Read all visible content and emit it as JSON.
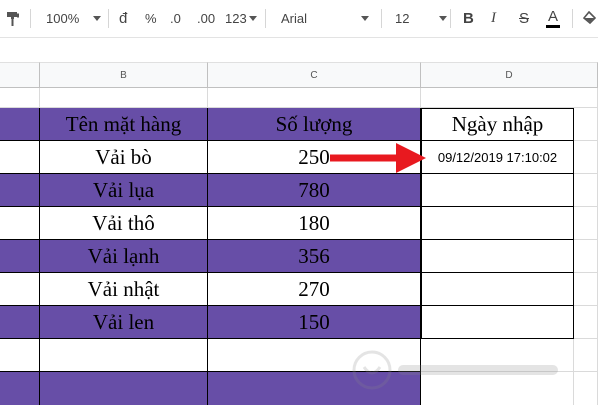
{
  "toolbar": {
    "zoom": "100%",
    "currency_symbol": "đ",
    "percent_symbol": "%",
    "decrease_decimals": ".0",
    "increase_decimals": ".00",
    "more_formats": "123",
    "font": "Arial",
    "font_size": "12",
    "bold": "B",
    "italic": "I",
    "strikethrough": "S",
    "text_color": "A"
  },
  "columns": [
    "B",
    "C",
    "D"
  ],
  "table": {
    "headers": [
      "Tên mặt hàng",
      "Số lượng",
      "Ngày nhập"
    ],
    "rows": [
      {
        "name": "Vải bò",
        "qty": "250",
        "date": "09/12/2019 17:10:02"
      },
      {
        "name": "Vải lụa",
        "qty": "780",
        "date": ""
      },
      {
        "name": "Vải thô",
        "qty": "180",
        "date": ""
      },
      {
        "name": "Vải lạnh",
        "qty": "356",
        "date": ""
      },
      {
        "name": "Vải nhật",
        "qty": "270",
        "date": ""
      },
      {
        "name": "Vải len",
        "qty": "150",
        "date": ""
      }
    ]
  },
  "colors": {
    "row_fill": "#674ea7",
    "arrow": "#e8191f",
    "text_color_underline": "#000000"
  },
  "icons": [
    "paint-format-icon",
    "fill-color-icon",
    "watermark-logo-icon"
  ]
}
